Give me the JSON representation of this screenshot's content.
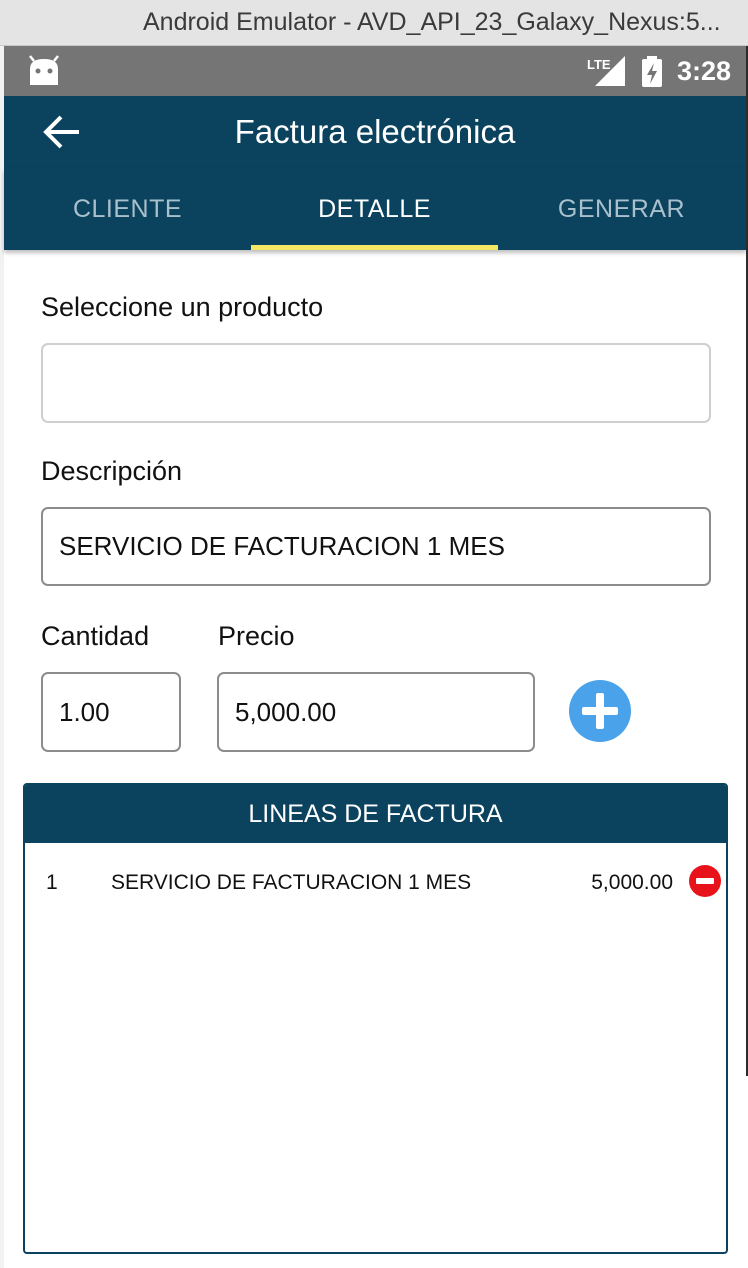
{
  "window": {
    "title": "Android Emulator - AVD_API_23_Galaxy_Nexus:5..."
  },
  "status_bar": {
    "network_label": "LTE",
    "time": "3:28",
    "icons": [
      "android-debug-icon",
      "lte-signal-icon",
      "battery-charging-icon"
    ]
  },
  "app_bar": {
    "title": "Factura electrónica",
    "back_icon": "arrow-left-icon"
  },
  "tabs": [
    {
      "label": "CLIENTE",
      "active": false
    },
    {
      "label": "DETALLE",
      "active": true
    },
    {
      "label": "GENERAR",
      "active": false
    }
  ],
  "form": {
    "product": {
      "label": "Seleccione un producto",
      "value": ""
    },
    "description": {
      "label": "Descripción",
      "value": "SERVICIO DE FACTURACION 1 MES"
    },
    "quantity": {
      "label": "Cantidad",
      "value": "1.00"
    },
    "price": {
      "label": "Precio",
      "value": "5,000.00"
    },
    "add_icon": "plus-circle-icon"
  },
  "invoice_lines": {
    "header": "LINEAS DE FACTURA",
    "rows": [
      {
        "number": "1",
        "description": "SERVICIO DE FACTURACION 1 MES",
        "price": "5,000.00"
      }
    ],
    "remove_icon": "minus-circle-icon"
  },
  "colors": {
    "primary": "#0b425e",
    "tab_indicator": "#f5e663",
    "add_button": "#4aa3ea",
    "remove_button": "#e8131a",
    "status_bar": "#757575"
  }
}
